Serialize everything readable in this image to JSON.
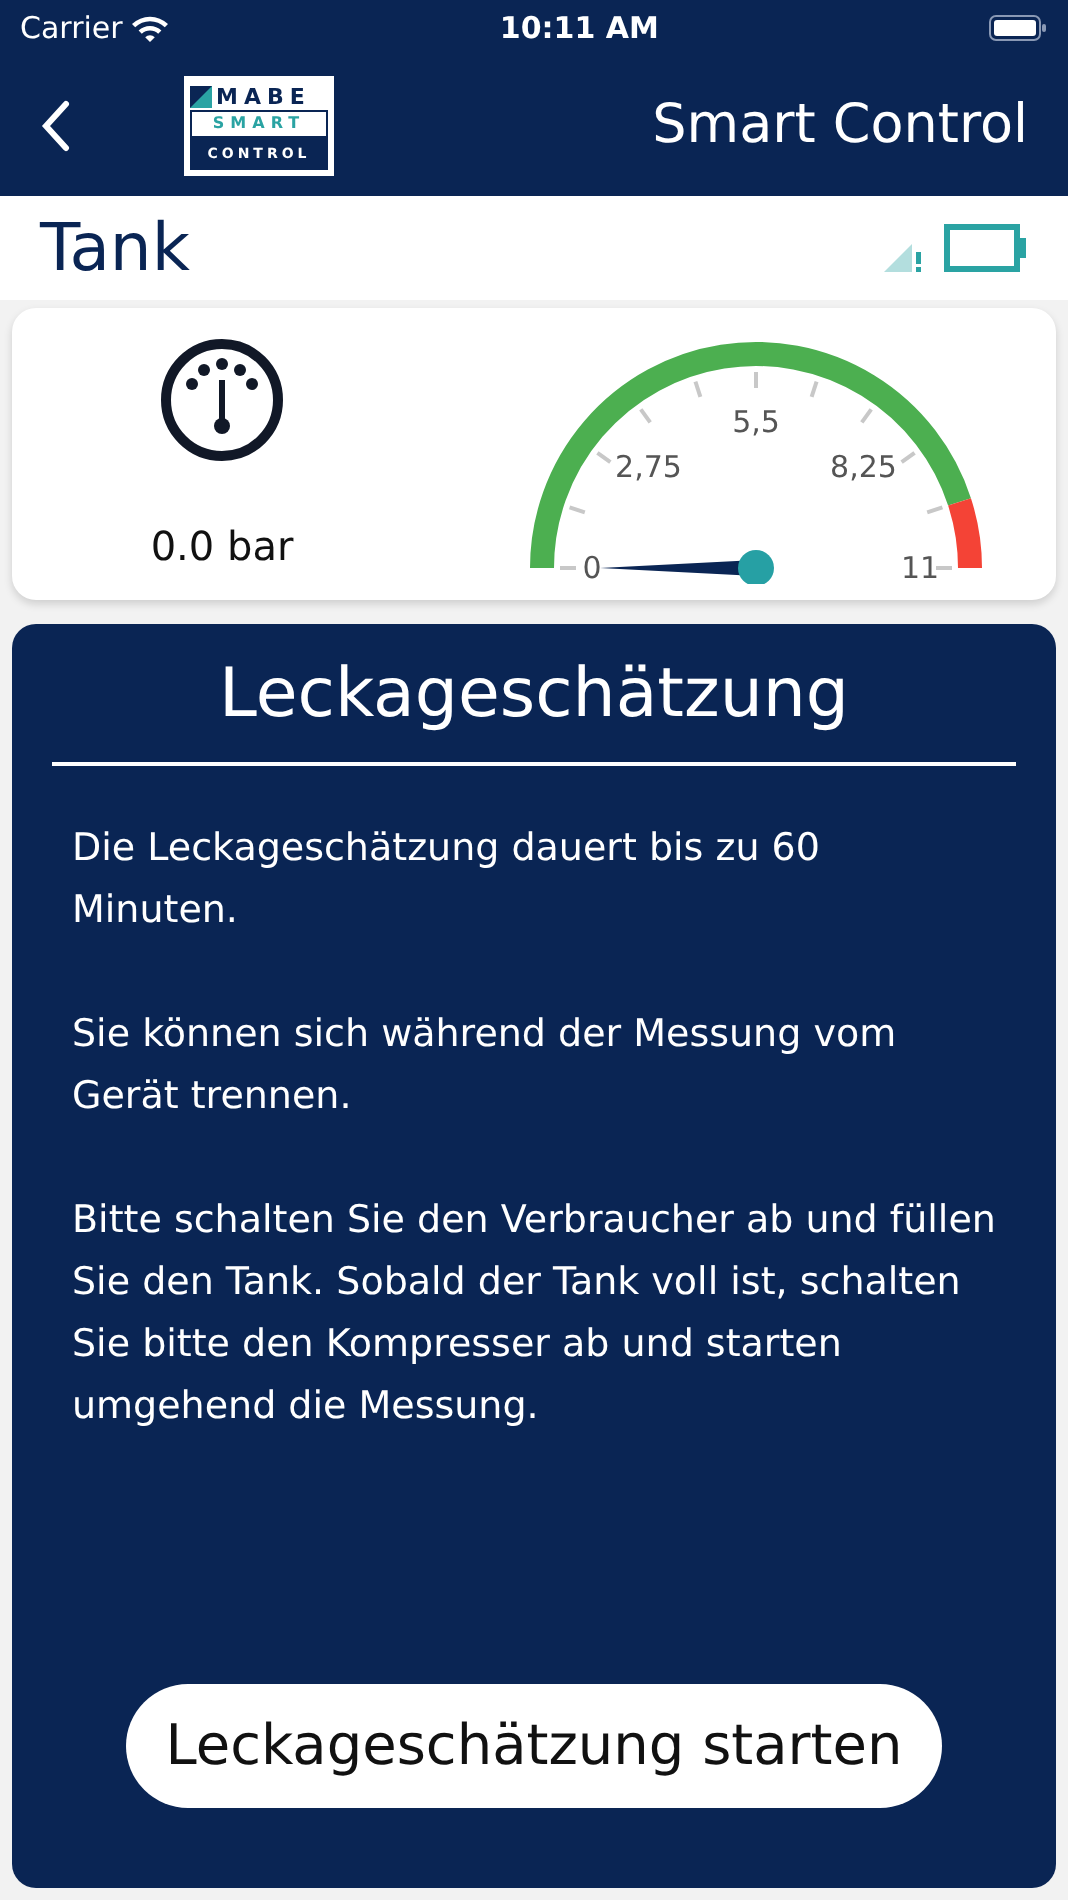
{
  "status_bar": {
    "carrier": "Carrier",
    "time": "10:11 AM"
  },
  "nav": {
    "logo": {
      "line_1": "MABE",
      "line_2": "SMART",
      "line_3": "CONTROL"
    },
    "title": "Smart Control"
  },
  "device": {
    "name": "Tank"
  },
  "pressure": {
    "reading": "0.0 bar",
    "gauge": {
      "labels": [
        "0",
        "2,75",
        "5,5",
        "8,25",
        "11"
      ]
    }
  },
  "panel": {
    "title": "Leckageschätzung",
    "paragraphs": [
      "Die Leckageschätzung dauert bis zu 60 Minuten.",
      "Sie können sich während der Messung vom Gerät trennen.",
      "Bitte schalten Sie den Verbraucher ab und füllen Sie den Tank. Sobald der Tank voll ist, schalten Sie bitte den Kompresser ab und starten umgehend die Messung."
    ],
    "button": "Leckageschätzung starten"
  }
}
